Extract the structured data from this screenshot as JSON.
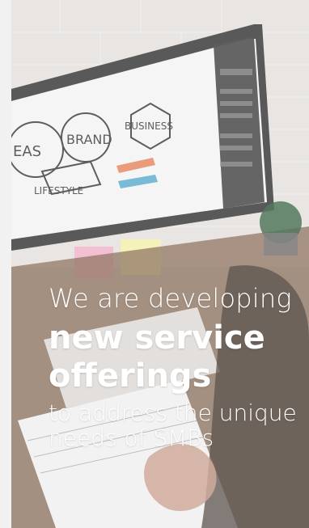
{
  "hero": {
    "headline_line1": "We are developing",
    "headline_line2": "new service",
    "headline_line3": "offerings",
    "subline_line1": "to address the unique",
    "subline_line2": "needs of SMBs"
  },
  "background": {
    "screen_badge_1": "EAS",
    "screen_badge_2": "BRAND",
    "screen_badge_3": "BUSINESS",
    "screen_badge_4": "LIFESTYLE"
  },
  "colors": {
    "text": "#ffffff",
    "overlay": "#ffffff",
    "left_strip": "#f1f1f1"
  }
}
